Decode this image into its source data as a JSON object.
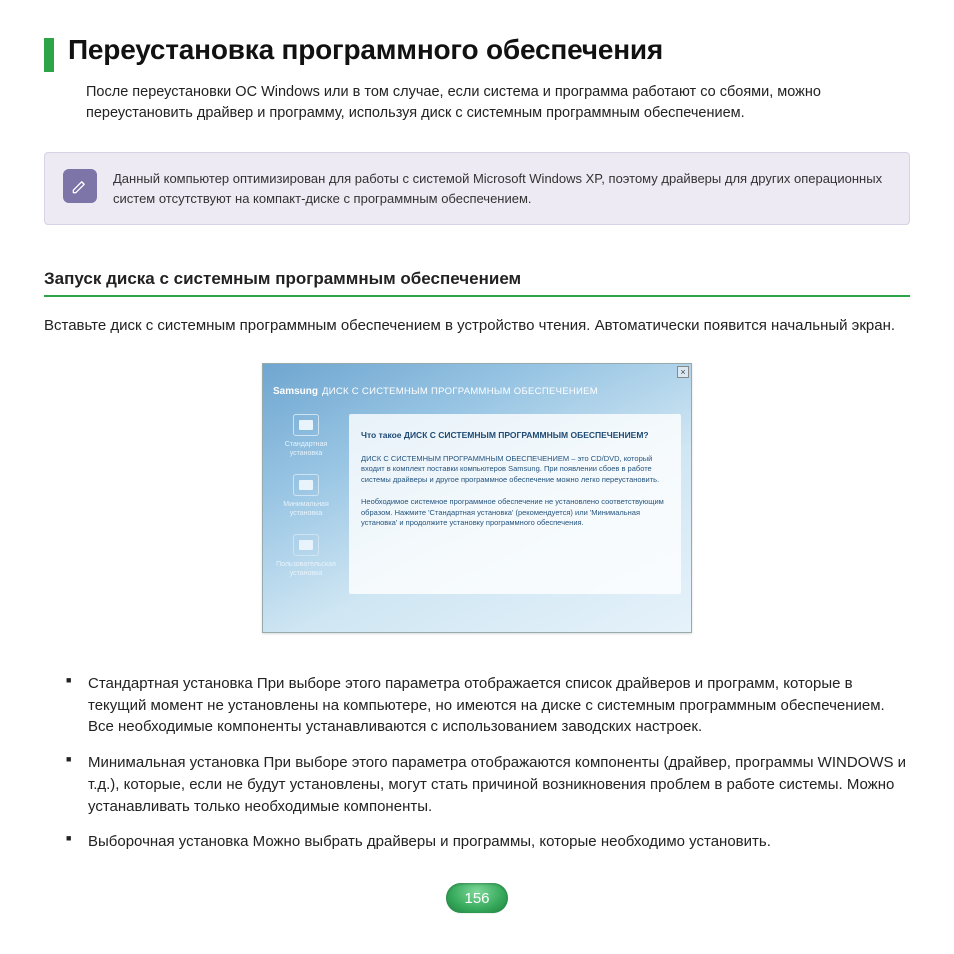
{
  "heading": "Переустановка программного обеспечения",
  "intro": "После переустановки ОС Windows или в том случае, если система и программа работают со сбоями, можно переустановить драйвер и программу, используя диск с системным программным обеспечением.",
  "note": "Данный компьютер оптимизирован для работы с системой Microsoft Windows XP, поэтому драйверы для других операционных систем отсутствуют на компакт-диске с программным обеспечением.",
  "section_heading": "Запуск диска с системным программным обеспечением",
  "section_body": "Вставьте диск с системным программным обеспечением в устройство чтения. Автоматически появится начальный экран.",
  "screenshot": {
    "brand": "Samsung",
    "title": "ДИСК С СИСТЕМНЫМ ПРОГРАММНЫМ ОБЕСПЕЧЕНИЕМ",
    "close": "×",
    "sidebar": [
      {
        "label": "Стандартная установка"
      },
      {
        "label": "Минимальная установка"
      },
      {
        "label": "Пользовательская установка"
      }
    ],
    "pane_heading": "Что такое ДИСК С СИСТЕМНЫМ ПРОГРАММНЫМ ОБЕСПЕЧЕНИЕМ?",
    "pane_p1": "ДИСК С СИСТЕМНЫМ ПРОГРАММНЫМ ОБЕСПЕЧЕНИЕМ – это CD/DVD, который входит в комплект поставки компьютеров Samsung. При появлении сбоев в работе системы драйверы и другое программное обеспечение можно легко переустановить.",
    "pane_p2": "Необходимое системное программное обеспечение не установлено соответствующим образом. Нажмите 'Стандартная установка' (рекомендуется) или 'Минимальная установка' и продолжите установку программного обеспечения."
  },
  "list": [
    "Стандартная установка При выборе этого параметра отображается список драйверов и программ, которые в текущий момент не установлены на компьютере, но имеются на диске с системным программным обеспечением. Все необходимые компоненты устанавливаются с использованием заводских настроек.",
    "Минимальная установка При выборе этого параметра отображаются компоненты (драйвер, программы WINDOWS и т.д.), которые, если не будут установлены, могут стать причиной возникновения проблем в работе системы. Можно устанавливать только необходимые компоненты.",
    "Выборочная установка Можно выбрать драйверы и программы, которые необходимо установить."
  ],
  "page_number": "156"
}
